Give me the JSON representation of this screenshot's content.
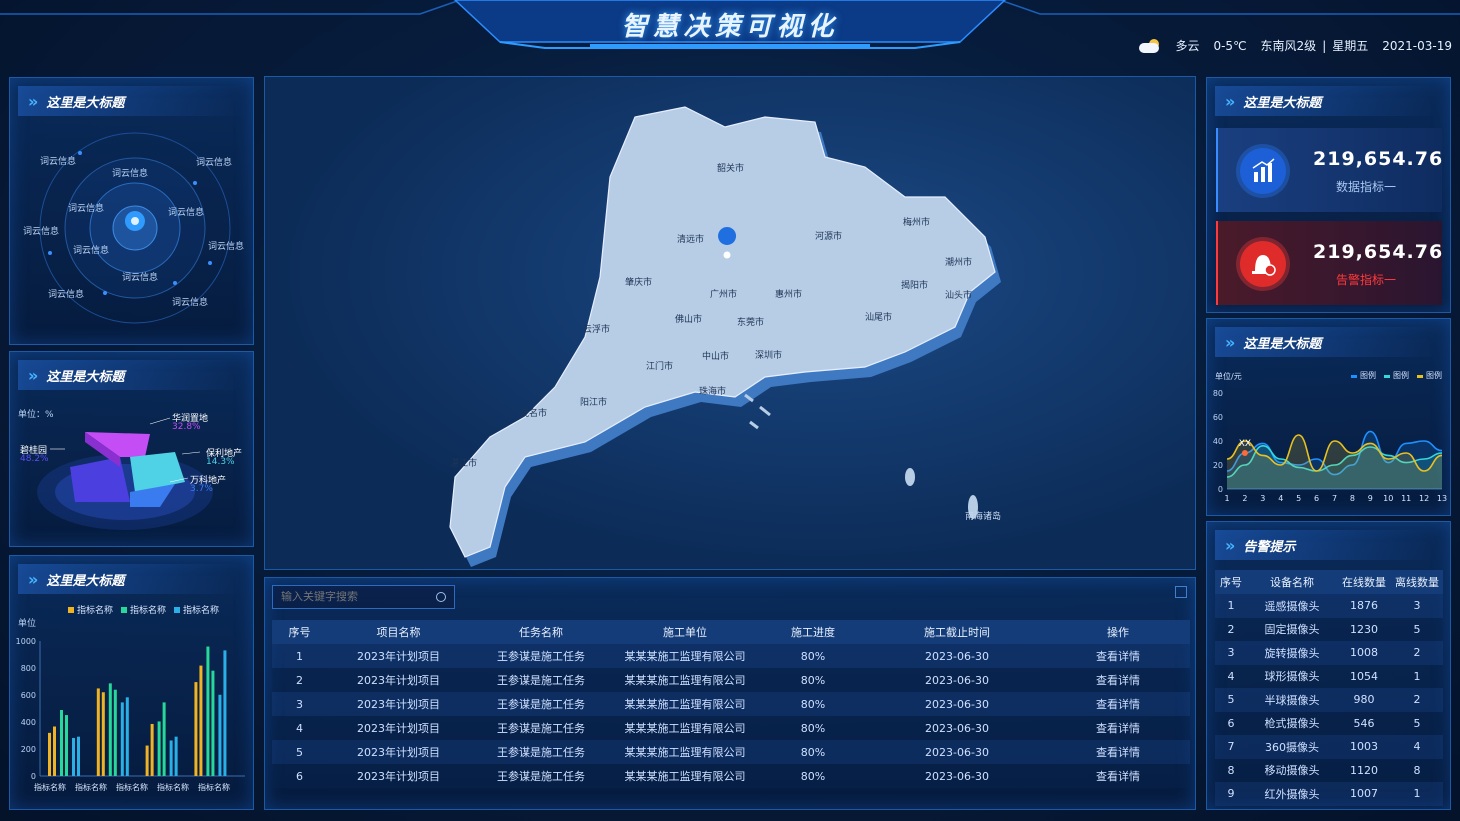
{
  "header": {
    "title": "智慧决策可视化"
  },
  "weather": {
    "icon": "partly-cloudy-icon",
    "condition": "多云",
    "temperature": "0-5℃",
    "wind": "东南风2级",
    "separator": "|",
    "weekday": "星期五",
    "date": "2021-03-19"
  },
  "panel_radar": {
    "title": "这里是大标题",
    "labels": [
      "词云信息",
      "词云信息",
      "词云信息",
      "词云信息",
      "词云信息",
      "词云信息",
      "词云信息",
      "词云信息",
      "词云信息",
      "词云信息",
      "词云信息",
      "词云信息"
    ]
  },
  "panel_pie": {
    "title": "这里是大标题",
    "unit": "单位：%",
    "slices": [
      {
        "name": "华润置地",
        "value": "32.8%",
        "color": "#c44df5"
      },
      {
        "name": "碧桂园",
        "value": "48.2%",
        "color": "#5b4ef5"
      },
      {
        "name": "保利地产",
        "value": "14.3%",
        "color": "#4fd1e6"
      },
      {
        "name": "万科地产",
        "value": "3.7%",
        "color": "#3a7bf0"
      }
    ]
  },
  "panel_bar": {
    "title": "这里是大标题",
    "chart_data": {
      "type": "bar",
      "categories": [
        "指标名称",
        "指标名称",
        "指标名称",
        "指标名称",
        "指标名称"
      ],
      "series": [
        {
          "name": "指标名称",
          "color": "#f0b324",
          "values": [
            [
              340,
              390
            ],
            [
              690,
              660
            ],
            [
              240,
              410
            ],
            [
              740,
              870
            ]
          ]
        },
        {
          "name": "指标名称",
          "color": "#27d89a",
          "values": [
            [
              520,
              480
            ],
            [
              730,
              680
            ],
            [
              430,
              580
            ],
            [
              1020,
              830
            ]
          ]
        },
        {
          "name": "指标名称",
          "color": "#2ab0e6",
          "values": [
            [
              300,
              310
            ],
            [
              580,
              620
            ],
            [
              280,
              310
            ],
            [
              640,
              990
            ]
          ]
        }
      ],
      "ylabel": "单位",
      "ylim": [
        0,
        1000
      ],
      "yticks": [
        "1000",
        "800",
        "600",
        "400",
        "200",
        "0"
      ]
    }
  },
  "map": {
    "cities": [
      "韶关市",
      "清远市",
      "河源市",
      "梅州市",
      "潮州市",
      "肇庆市",
      "广州市",
      "惠州市",
      "揭阳市",
      "汕头市",
      "佛山市",
      "东莞市",
      "汕尾市",
      "云浮市",
      "中山市",
      "深圳市",
      "江门市",
      "珠海市",
      "阳江市",
      "茂名市",
      "湛江市",
      "南海诸岛"
    ]
  },
  "search": {
    "placeholder": "输入关键字搜索"
  },
  "project_table": {
    "columns": [
      "序号",
      "项目名称",
      "任务名称",
      "施工单位",
      "施工进度",
      "施工截止时间",
      "操作"
    ],
    "rows": [
      [
        "1",
        "2023年计划项目",
        "王参谋是施工任务",
        "某某某施工监理有限公司",
        "80%",
        "2023-06-30",
        "查看详情"
      ],
      [
        "2",
        "2023年计划项目",
        "王参谋是施工任务",
        "某某某施工监理有限公司",
        "80%",
        "2023-06-30",
        "查看详情"
      ],
      [
        "3",
        "2023年计划项目",
        "王参谋是施工任务",
        "某某某施工监理有限公司",
        "80%",
        "2023-06-30",
        "查看详情"
      ],
      [
        "4",
        "2023年计划项目",
        "王参谋是施工任务",
        "某某某施工监理有限公司",
        "80%",
        "2023-06-30",
        "查看详情"
      ],
      [
        "5",
        "2023年计划项目",
        "王参谋是施工任务",
        "某某某施工监理有限公司",
        "80%",
        "2023-06-30",
        "查看详情"
      ],
      [
        "6",
        "2023年计划项目",
        "王参谋是施工任务",
        "某某某施工监理有限公司",
        "80%",
        "2023-06-30",
        "查看详情"
      ]
    ]
  },
  "kpi": {
    "title": "这里是大标题",
    "items": [
      {
        "value": "219,654.76",
        "label": "数据指标一",
        "icon": "chart-icon",
        "color": "#a9c7f0"
      },
      {
        "value": "219,654.76",
        "label": "告警指标一",
        "icon": "alarm-icon",
        "color": "#ff3a3a"
      }
    ]
  },
  "panel_line": {
    "title": "这里是大标题",
    "chart_data": {
      "type": "area",
      "x": [
        "1",
        "2",
        "3",
        "4",
        "5",
        "6",
        "7",
        "8",
        "9",
        "10",
        "11",
        "12",
        "13"
      ],
      "series": [
        {
          "name": "图例",
          "color": "#1e90ff",
          "values": [
            15,
            30,
            38,
            22,
            20,
            25,
            12,
            20,
            48,
            22,
            38,
            40,
            32
          ]
        },
        {
          "name": "图例",
          "color": "#34d9d9",
          "values": [
            10,
            20,
            36,
            25,
            18,
            15,
            20,
            28,
            35,
            28,
            22,
            25,
            30
          ]
        },
        {
          "name": "图例",
          "color": "#e8c020",
          "values": [
            25,
            40,
            28,
            20,
            45,
            15,
            40,
            30,
            38,
            25,
            30,
            15,
            28
          ]
        }
      ],
      "ylabel": "单位/元",
      "ylim": [
        0,
        80
      ],
      "yticks": [
        "80",
        "60",
        "40",
        "20",
        "0"
      ],
      "annotation": "XX"
    }
  },
  "alarm": {
    "title": "告警提示",
    "columns": [
      "序号",
      "设备名称",
      "在线数量",
      "离线数量"
    ],
    "rows": [
      [
        "1",
        "遥感摄像头",
        "1876",
        "3"
      ],
      [
        "2",
        "固定摄像头",
        "1230",
        "5"
      ],
      [
        "3",
        "旋转摄像头",
        "1008",
        "2"
      ],
      [
        "4",
        "球形摄像头",
        "1054",
        "1"
      ],
      [
        "5",
        "半球摄像头",
        "980",
        "2"
      ],
      [
        "6",
        "枪式摄像头",
        "546",
        "5"
      ],
      [
        "7",
        "360摄像头",
        "1003",
        "4"
      ],
      [
        "8",
        "移动摄像头",
        "1120",
        "8"
      ],
      [
        "9",
        "红外摄像头",
        "1007",
        "1"
      ]
    ]
  }
}
